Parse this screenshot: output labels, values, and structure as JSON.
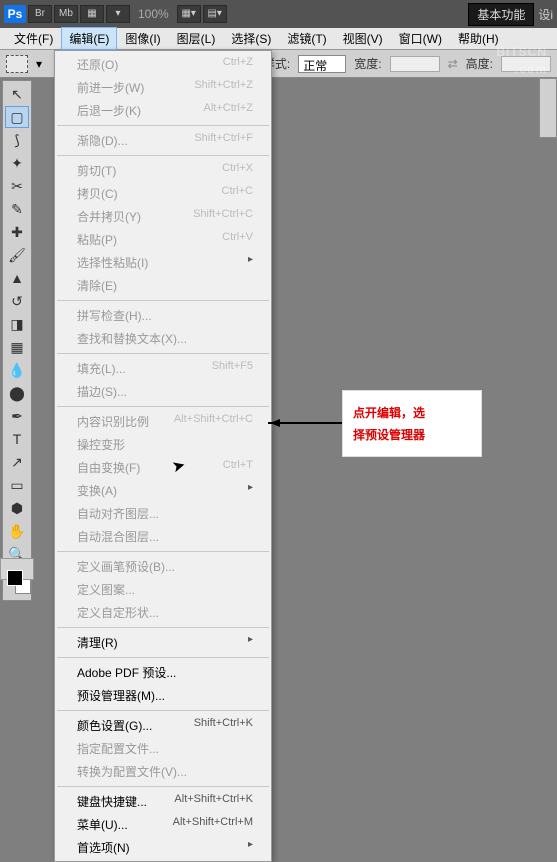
{
  "app": {
    "logo": "Ps",
    "zoom": "100%"
  },
  "topbuttons": {
    "br": "Br",
    "mb": "Mb"
  },
  "topright": {
    "basic": "基本功能",
    "design": "设i"
  },
  "menubar": {
    "file": "文件(F)",
    "edit": "编辑(E)",
    "image": "图像(I)",
    "layer": "图层(L)",
    "select": "选择(S)",
    "filter": "滤镜(T)",
    "view": "视图(V)",
    "window": "窗口(W)",
    "help": "帮助(H)"
  },
  "options": {
    "style": "样式:",
    "style_val": "正常",
    "width": "宽度:",
    "height": "高度:"
  },
  "menu": {
    "undo": "还原(O)",
    "undo_sc": "Ctrl+Z",
    "stepfw": "前进一步(W)",
    "stepfw_sc": "Shift+Ctrl+Z",
    "stepbk": "后退一步(K)",
    "stepbk_sc": "Alt+Ctrl+Z",
    "fade": "渐隐(D)...",
    "fade_sc": "Shift+Ctrl+F",
    "cut": "剪切(T)",
    "cut_sc": "Ctrl+X",
    "copy": "拷贝(C)",
    "copy_sc": "Ctrl+C",
    "copymerge": "合并拷贝(Y)",
    "copymerge_sc": "Shift+Ctrl+C",
    "paste": "粘贴(P)",
    "paste_sc": "Ctrl+V",
    "pastesp": "选择性粘贴(I)",
    "clear": "清除(E)",
    "spell": "拼写检查(H)...",
    "findrep": "查找和替换文本(X)...",
    "fill": "填充(L)...",
    "fill_sc": "Shift+F5",
    "stroke": "描边(S)...",
    "contentscale": "内容识别比例",
    "contentscale_sc": "Alt+Shift+Ctrl+C",
    "puppet": "操控变形",
    "freetrans": "自由变换(F)",
    "freetrans_sc": "Ctrl+T",
    "transform": "变换(A)",
    "autoalign": "自动对齐图层...",
    "autoblend": "自动混合图层...",
    "brushpreset": "定义画笔预设(B)...",
    "pattern": "定义图案...",
    "customshape": "定义自定形状...",
    "purge": "清理(R)",
    "adobepdf": "Adobe PDF 预设...",
    "presetmgr": "预设管理器(M)...",
    "colorset": "颜色设置(G)...",
    "colorset_sc": "Shift+Ctrl+K",
    "assignprof": "指定配置文件...",
    "convertprof": "转换为配置文件(V)...",
    "keyshort": "键盘快捷键...",
    "keyshort_sc": "Alt+Shift+Ctrl+K",
    "menus": "菜单(U)...",
    "menus_sc": "Alt+Shift+Ctrl+M",
    "prefs": "首选项(N)"
  },
  "annotation": {
    "line1": "点开编辑，选",
    "line2": "择预设管理器"
  },
  "watermark": {
    "main": "BITSCN",
    "sub": ".com"
  }
}
